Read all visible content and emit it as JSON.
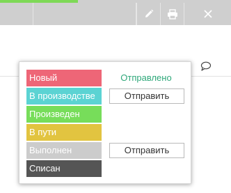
{
  "toolbar": {
    "accent_color": "#7ed957",
    "background_color": "#cfcfcf",
    "buttons": [
      {
        "icon": "pencil-icon",
        "action": "edit"
      },
      {
        "icon": "printer-icon",
        "action": "print"
      },
      {
        "icon": "close-icon",
        "action": "close"
      }
    ]
  },
  "row": {
    "comment_icon": "speech-bubble-icon"
  },
  "status_popup": {
    "statuses": [
      {
        "label": "Новый",
        "color": "#ee6677",
        "action_type": "sent",
        "action_text": "Отправлено"
      },
      {
        "label": "В производстве",
        "color": "#5bd3d3",
        "action_type": "button",
        "action_text": "Отправить"
      },
      {
        "label": "Произведен",
        "color": "#77dd5a",
        "action_type": "none",
        "action_text": ""
      },
      {
        "label": "В пути",
        "color": "#e2c440",
        "action_type": "none",
        "action_text": ""
      },
      {
        "label": "Выполнен",
        "color": "#cccccc",
        "action_type": "button",
        "action_text": "Отправить"
      },
      {
        "label": "Списан",
        "color": "#555555",
        "action_type": "none",
        "action_text": ""
      }
    ],
    "sent_color": "#2fa87a"
  }
}
